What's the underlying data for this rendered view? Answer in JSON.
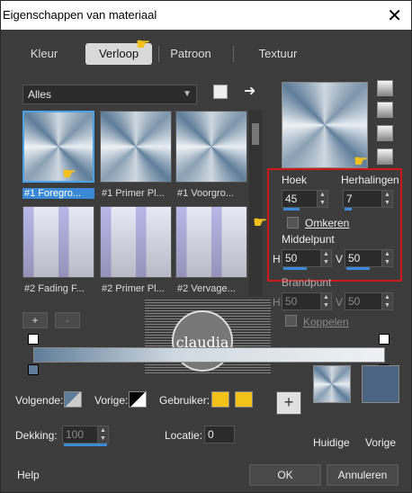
{
  "window": {
    "title": "Eigenschappen van materiaal",
    "close_glyph": "✕"
  },
  "tabs": [
    {
      "label": "Kleur"
    },
    {
      "label": "Verloop"
    },
    {
      "label": "Patroon"
    },
    {
      "label": "Textuur"
    }
  ],
  "category": {
    "selected": "Alles"
  },
  "thumbs": [
    {
      "caption": "#1 Foregro..."
    },
    {
      "caption": "#1 Primer Pl..."
    },
    {
      "caption": "#1 Voorgro..."
    },
    {
      "caption": "#2 Fading F..."
    },
    {
      "caption": "#2 Primer Pl..."
    },
    {
      "caption": "#2 Vervage..."
    }
  ],
  "list_buttons": {
    "add": "+",
    "remove": "-"
  },
  "settings": {
    "angle_label": "Hoek",
    "angle_value": "45",
    "repeats_label": "Herhalingen",
    "repeats_value": "7",
    "invert_label": "Omkeren",
    "center_label": "Middelpunt",
    "center_h_label": "H",
    "center_h_value": "50",
    "center_v_label": "V",
    "center_v_value": "50",
    "focal_label": "Brandpunt",
    "focal_h_label": "H",
    "focal_h_value": "50",
    "focal_v_label": "V",
    "focal_v_value": "50",
    "link_label": "Koppelen"
  },
  "colors": {
    "volgende_label": "Volgende:",
    "vorige_label": "Vorige:",
    "gebruiker_label": "Gebruiker:",
    "user_color": "#f2c21a",
    "opacity_label": "Dekking:",
    "opacity_value": "100",
    "location_label": "Locatie:",
    "location_value": "0"
  },
  "swatches": {
    "huidige_label": "Huidige",
    "vorige_label": "Vorige",
    "vorige_color": "#4a6482"
  },
  "footer": {
    "help": "Help",
    "ok": "OK",
    "cancel": "Annuleren"
  },
  "watermark": {
    "text": "claudia"
  }
}
